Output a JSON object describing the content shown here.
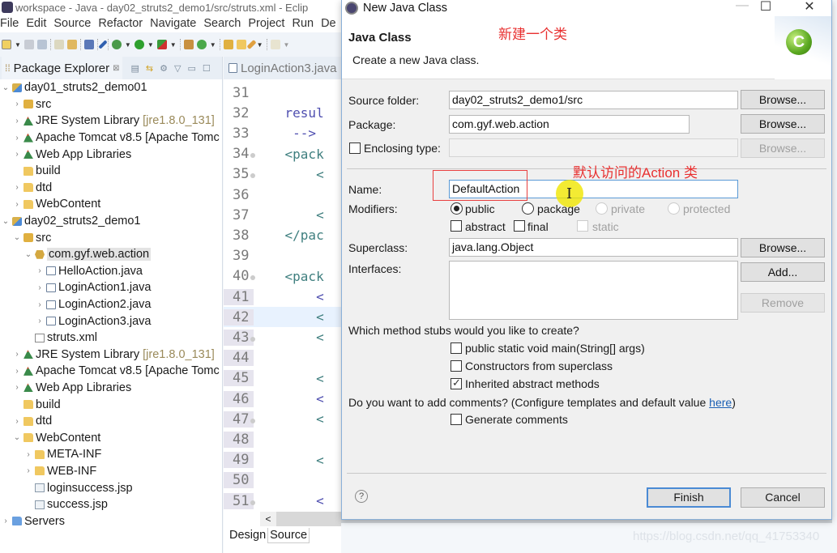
{
  "window": {
    "title": "workspace - Java - day02_struts2_demo1/src/struts.xml - Eclip",
    "menu": [
      "File",
      "Edit",
      "Source",
      "Refactor",
      "Navigate",
      "Search",
      "Project",
      "Run",
      "De"
    ]
  },
  "package_explorer": {
    "title": "Package Explorer",
    "close_glyph": "⊠",
    "tree": [
      {
        "indent": 0,
        "twisty": "⌄",
        "icon": "project",
        "label": "day01_struts2_demo01"
      },
      {
        "indent": 1,
        "twisty": "›",
        "icon": "src",
        "label": "src"
      },
      {
        "indent": 1,
        "twisty": "›",
        "icon": "lib",
        "label": "JRE System Library",
        "deco": "[jre1.8.0_131]"
      },
      {
        "indent": 1,
        "twisty": "›",
        "icon": "lib",
        "label": "Apache Tomcat v8.5 [Apache Tomc"
      },
      {
        "indent": 1,
        "twisty": "›",
        "icon": "lib",
        "label": "Web App Libraries"
      },
      {
        "indent": 1,
        "twisty": "",
        "icon": "folder",
        "label": "build"
      },
      {
        "indent": 1,
        "twisty": "›",
        "icon": "folder",
        "label": "dtd"
      },
      {
        "indent": 1,
        "twisty": "›",
        "icon": "folder",
        "label": "WebContent"
      },
      {
        "indent": 0,
        "twisty": "⌄",
        "icon": "project",
        "label": "day02_struts2_demo1"
      },
      {
        "indent": 1,
        "twisty": "⌄",
        "icon": "src",
        "label": "src"
      },
      {
        "indent": 2,
        "twisty": "⌄",
        "icon": "pkg",
        "label": "com.gyf.web.action",
        "selected": true
      },
      {
        "indent": 3,
        "twisty": "›",
        "icon": "java",
        "label": "HelloAction.java"
      },
      {
        "indent": 3,
        "twisty": "›",
        "icon": "java",
        "label": "LoginAction1.java"
      },
      {
        "indent": 3,
        "twisty": "›",
        "icon": "java",
        "label": "LoginAction2.java"
      },
      {
        "indent": 3,
        "twisty": "›",
        "icon": "java",
        "label": "LoginAction3.java"
      },
      {
        "indent": 2,
        "twisty": "",
        "icon": "xml",
        "label": "struts.xml"
      },
      {
        "indent": 1,
        "twisty": "›",
        "icon": "lib",
        "label": "JRE System Library",
        "deco": "[jre1.8.0_131]"
      },
      {
        "indent": 1,
        "twisty": "›",
        "icon": "lib",
        "label": "Apache Tomcat v8.5 [Apache Tomc"
      },
      {
        "indent": 1,
        "twisty": "›",
        "icon": "lib",
        "label": "Web App Libraries"
      },
      {
        "indent": 1,
        "twisty": "",
        "icon": "folder",
        "label": "build"
      },
      {
        "indent": 1,
        "twisty": "›",
        "icon": "folder",
        "label": "dtd"
      },
      {
        "indent": 1,
        "twisty": "⌄",
        "icon": "folder",
        "label": "WebContent"
      },
      {
        "indent": 2,
        "twisty": "›",
        "icon": "folder",
        "label": "META-INF"
      },
      {
        "indent": 2,
        "twisty": "›",
        "icon": "folder",
        "label": "WEB-INF"
      },
      {
        "indent": 2,
        "twisty": "",
        "icon": "jsp",
        "label": "loginsuccess.jsp"
      },
      {
        "indent": 2,
        "twisty": "",
        "icon": "jsp",
        "label": "success.jsp"
      },
      {
        "indent": 0,
        "twisty": "›",
        "icon": "folder-blue",
        "label": "Servers"
      }
    ]
  },
  "editor": {
    "tab_label": "LoginAction3.java",
    "lines": [
      {
        "n": "31",
        "text": "",
        "fold": false
      },
      {
        "n": "32",
        "text": "    resul",
        "fold": false,
        "kind": "attr"
      },
      {
        "n": "33",
        "text": "     -->",
        "fold": false,
        "kind": "attr"
      },
      {
        "n": "34",
        "text": "    <pack",
        "fold": true
      },
      {
        "n": "35",
        "text": "        <",
        "fold": true
      },
      {
        "n": "36",
        "text": "",
        "fold": false
      },
      {
        "n": "37",
        "text": "        <",
        "fold": false
      },
      {
        "n": "38",
        "text": "    </pac",
        "fold": false
      },
      {
        "n": "39",
        "text": "",
        "fold": false
      },
      {
        "n": "40",
        "text": "    <pack",
        "fold": true
      },
      {
        "n": "41",
        "text": "        <",
        "fold": false,
        "kind": "attr"
      },
      {
        "n": "42",
        "text": "        <",
        "fold": false,
        "current": true
      },
      {
        "n": "43",
        "text": "        <",
        "fold": true
      },
      {
        "n": "44",
        "text": "",
        "fold": false
      },
      {
        "n": "45",
        "text": "        <",
        "fold": false
      },
      {
        "n": "46",
        "text": "        <",
        "fold": false,
        "kind": "attr"
      },
      {
        "n": "47",
        "text": "        <",
        "fold": true
      },
      {
        "n": "48",
        "text": "",
        "fold": false
      },
      {
        "n": "49",
        "text": "        <",
        "fold": false
      },
      {
        "n": "50",
        "text": "",
        "fold": false
      },
      {
        "n": "51",
        "text": "        <",
        "fold": true,
        "kind": "attr"
      }
    ],
    "scroll_left_glyph": "<",
    "bottom_tabs": {
      "design": "Design",
      "source": "Source"
    }
  },
  "dialog": {
    "title": "New Java Class",
    "minimize": "—",
    "maximize": "☐",
    "close": "✕",
    "banner_title": "Java Class",
    "banner_desc": "Create a new Java class.",
    "banner_annotation": "新建一个类",
    "banner_logo": "C",
    "source_folder": {
      "label": "Source folder:",
      "value": "day02_struts2_demo1/src",
      "button": "Browse..."
    },
    "package": {
      "label": "Package:",
      "value": "com.gyf.web.action",
      "button": "Browse..."
    },
    "enclosing_type": {
      "label": "Enclosing type:",
      "value": "",
      "checked": false,
      "button": "Browse..."
    },
    "name": {
      "label": "Name:",
      "value": "DefaultAction"
    },
    "name_annotation": "默认访问的Action 类",
    "modifiers": {
      "label": "Modifiers:",
      "visibility": [
        {
          "label": "public",
          "checked": true,
          "enabled": true
        },
        {
          "label": "package",
          "checked": false,
          "enabled": true
        },
        {
          "label": "private",
          "checked": false,
          "enabled": false
        },
        {
          "label": "protected",
          "checked": false,
          "enabled": false
        }
      ],
      "flags": [
        {
          "label": "abstract",
          "checked": false,
          "enabled": true
        },
        {
          "label": "final",
          "checked": false,
          "enabled": true
        },
        {
          "label": "static",
          "checked": false,
          "enabled": false
        }
      ]
    },
    "superclass": {
      "label": "Superclass:",
      "value": "java.lang.Object",
      "button": "Browse..."
    },
    "interfaces": {
      "label": "Interfaces:",
      "add_button": "Add...",
      "remove_button": "Remove",
      "items": []
    },
    "stubs": {
      "question": "Which method stubs would you like to create?",
      "options": [
        {
          "label": "public static void main(String[] args)",
          "checked": false
        },
        {
          "label": "Constructors from superclass",
          "checked": false
        },
        {
          "label": "Inherited abstract methods",
          "checked": true
        }
      ]
    },
    "comments": {
      "question_prefix": "Do you want to add comments? (Configure templates and default value ",
      "link": "here",
      "question_suffix": ")",
      "option": {
        "label": "Generate comments",
        "checked": false
      }
    },
    "help_glyph": "?",
    "finish": "Finish",
    "cancel": "Cancel"
  },
  "watermark": "https://blog.csdn.net/qq_41753340"
}
